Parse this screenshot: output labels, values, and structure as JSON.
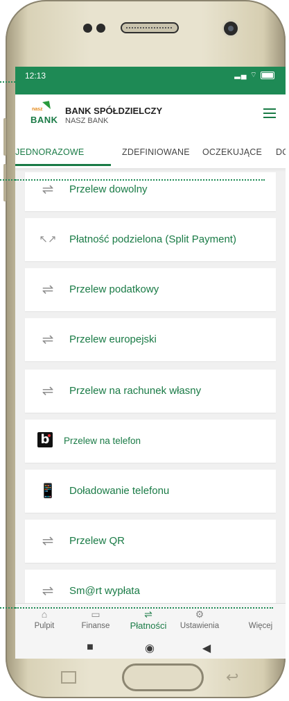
{
  "status_bar": {
    "time": "12:13",
    "icons": "signal wifi battery"
  },
  "bank": {
    "logo_small": "nasz",
    "logo_main": "BANK",
    "name": "BANK SPÓŁDZIELCZY",
    "subname": "NASZ BANK"
  },
  "tabs": [
    {
      "label": "JEDNORAZOWE",
      "active": true
    },
    {
      "label": "ZDEFINIOWANE",
      "active": false
    },
    {
      "label": "OCZEKUJĄCE",
      "active": false
    },
    {
      "label": "DO",
      "active": false
    }
  ],
  "payments": [
    {
      "label": "Przelew dowolny",
      "icon": "transfer-arrows-icon"
    },
    {
      "label": "Płatność podzielona (Split Payment)",
      "icon": "split-arrows-icon"
    },
    {
      "label": "Przelew podatkowy",
      "icon": "transfer-arrows-icon"
    },
    {
      "label": "Przelew europejski",
      "icon": "transfer-arrows-icon"
    },
    {
      "label": "Przelew na rachunek własny",
      "icon": "transfer-arrows-icon"
    },
    {
      "label": "Przelew na telefon",
      "icon": "blik-icon"
    },
    {
      "label": "Doładowanie telefonu",
      "icon": "phone-topup-icon"
    },
    {
      "label": "Przelew QR",
      "icon": "transfer-arrows-icon"
    },
    {
      "label": "Sm@rt wypłata",
      "icon": "transfer-arrows-icon"
    }
  ],
  "bottom_nav": [
    {
      "label": "Pulpit",
      "icon": "home-icon",
      "active": false
    },
    {
      "label": "Finanse",
      "icon": "wallet-icon",
      "active": false
    },
    {
      "label": "Płatności",
      "icon": "transfer-arrows-icon",
      "active": true
    },
    {
      "label": "Ustawienia",
      "icon": "gear-icon",
      "active": false
    },
    {
      "label": "Więcej",
      "icon": "more-icon",
      "active": false
    }
  ],
  "colors": {
    "brand_green": "#1a7b46",
    "status_green": "#1e8a55",
    "list_bg": "#f0f0f0"
  }
}
